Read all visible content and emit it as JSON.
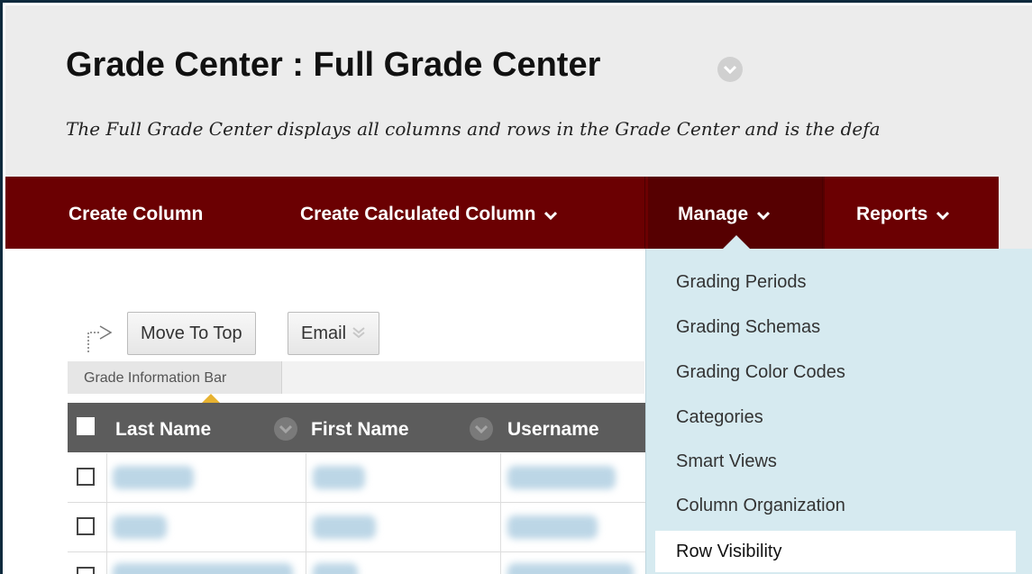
{
  "header": {
    "title": "Grade Center : Full Grade Center",
    "description": "The Full Grade Center displays all columns and rows in the Grade Center and is the defa"
  },
  "action_bar": {
    "create_column": "Create Column",
    "create_calculated_column": "Create Calculated Column",
    "manage": "Manage",
    "reports": "Reports"
  },
  "toolbar": {
    "move_to_top": "Move To Top",
    "email": "Email",
    "grade_information_bar": "Grade Information Bar"
  },
  "table": {
    "columns": [
      "Last Name",
      "First Name",
      "Username"
    ],
    "rows_visible": 3
  },
  "manage_menu": {
    "items": [
      "Grading Periods",
      "Grading Schemas",
      "Grading Color Codes",
      "Categories",
      "Smart Views",
      "Column Organization",
      "Row Visibility"
    ],
    "highlighted": "Row Visibility"
  },
  "colors": {
    "action_bar": "#6b0002",
    "menu_background": "#d6eaf0",
    "table_header": "#5c5c5c",
    "sort_indicator": "#e7b230"
  },
  "icons": [
    "chevron-down-icon",
    "arrow-right-icon",
    "column-menu-icon",
    "checkbox-icon"
  ]
}
